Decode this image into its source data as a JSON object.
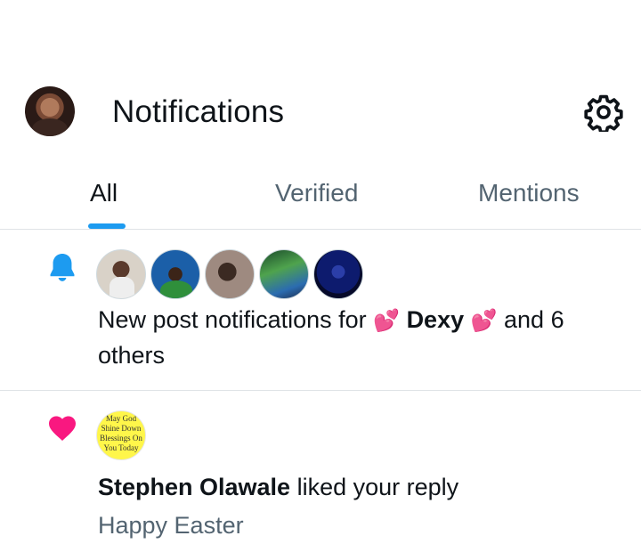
{
  "header": {
    "title": "Notifications",
    "profile_avatar": "user-avatar",
    "settings_icon": "gear-icon"
  },
  "tabs": [
    {
      "label": "All",
      "active": true
    },
    {
      "label": "Verified",
      "active": false
    },
    {
      "label": "Mentions",
      "active": false
    }
  ],
  "colors": {
    "accent": "#1d9bf0",
    "like": "#f91880",
    "text": "#0f1419",
    "secondary_text": "#536471"
  },
  "notifications": [
    {
      "icon": "bell-icon",
      "text_prefix": "New post notifications for ",
      "emoji_left": "💕",
      "name": "Dexy",
      "emoji_right": "💕",
      "text_suffix": " and 6 others"
    },
    {
      "icon": "heart-icon",
      "avatar_text": "May God Shine Down Blessings On You Today",
      "name": "Stephen Olawale",
      "action": " liked your reply",
      "reply_text": "Happy Easter"
    }
  ]
}
